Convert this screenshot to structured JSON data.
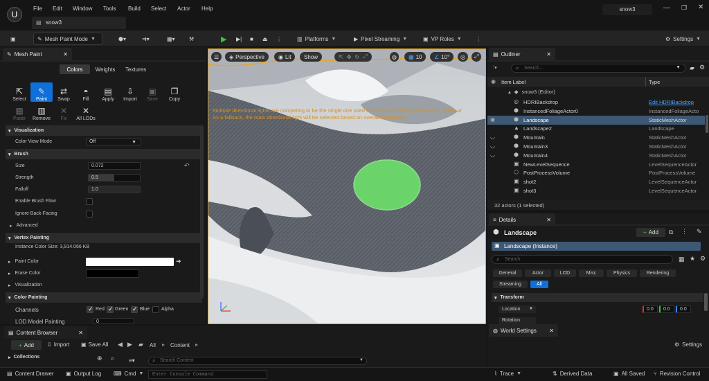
{
  "app": {
    "menu": [
      "File",
      "Edit",
      "Window",
      "Tools",
      "Build",
      "Select",
      "Actor",
      "Help"
    ],
    "project_name": "snow3",
    "doc_tab": "snow3"
  },
  "toolbar": {
    "mode": "Mesh Paint Mode",
    "platforms": "Platforms",
    "pixel_streaming": "Pixel Streaming",
    "vp_roles": "VP Roles",
    "settings": "Settings"
  },
  "mesh_paint": {
    "tab_title": "Mesh Paint",
    "segments": [
      "Colors",
      "Weights",
      "Textures"
    ],
    "tools_row1": [
      {
        "label": "Select",
        "icon": "cursor-icon",
        "glyph": "⇱",
        "dim": false
      },
      {
        "label": "Paint",
        "icon": "paint-brush-icon",
        "glyph": "✎",
        "dim": false,
        "active": true
      },
      {
        "label": "Swap",
        "icon": "swap-icon",
        "glyph": "⇄",
        "dim": false
      },
      {
        "label": "Fill",
        "icon": "fill-bucket-icon",
        "glyph": "◓",
        "dim": false
      },
      {
        "label": "Apply",
        "icon": "apply-icon",
        "glyph": "▤",
        "dim": false
      },
      {
        "label": "Import",
        "icon": "import-icon",
        "glyph": "⇩",
        "dim": false
      },
      {
        "label": "Save",
        "icon": "save-icon",
        "glyph": "▣",
        "dim": true
      },
      {
        "label": "Copy",
        "icon": "copy-icon",
        "glyph": "❐",
        "dim": false
      }
    ],
    "tools_row2": [
      {
        "label": "Paste",
        "icon": "paste-icon",
        "glyph": "▦",
        "dim": true
      },
      {
        "label": "Remove",
        "icon": "remove-icon",
        "glyph": "▥",
        "dim": false
      },
      {
        "label": "Fix",
        "icon": "fix-icon",
        "glyph": "✕",
        "dim": true
      },
      {
        "label": "All LODs",
        "icon": "lods-icon",
        "glyph": "✕",
        "dim": false
      }
    ],
    "visualization": {
      "header": "Visualization",
      "color_view_mode_label": "Color View Mode",
      "color_view_mode_value": "Off"
    },
    "brush": {
      "header": "Brush",
      "size_label": "Size",
      "size_value": "0.072",
      "strength_label": "Strength",
      "strength_value": "0.5",
      "falloff_label": "Falloff",
      "falloff_value": "1.0",
      "flow_label": "Enable Brush Flow",
      "backface_label": "Ignore Back-Facing"
    },
    "advanced": "Advanced",
    "vertex_painting": {
      "header": "Vertex Painting",
      "instance_size": "Instance Color Size: 3,914.066 KB",
      "paint_color_label": "Paint Color",
      "erase_color_label": "Erase Color",
      "visualization_label": "Visualization"
    },
    "color_painting": {
      "header": "Color Painting",
      "channels_label": "Channels",
      "channels": [
        "Red",
        "Green",
        "Blue",
        "Alpha"
      ],
      "lod_label": "LOD Model Painting",
      "lod_value": "0"
    }
  },
  "viewport": {
    "perspective": "Perspective",
    "lit": "Lit",
    "show": "Show",
    "grid_value": "10",
    "angle_value": "10°",
    "warning_line1": "Multiple directional lights are competing to be the single one used for forward shading, translucent, water or",
    "warning_line2": "As a fallback, the main directional light will be selected based on overall brightness.",
    "brush_color": "#6de86a",
    "border_color": "#d79d29"
  },
  "outliner": {
    "title": "Outliner",
    "search_placeholder": "Search...",
    "col_label": "Item Label",
    "col_type": "Type",
    "root": "snow3 (Editor)",
    "rows": [
      {
        "label": "HDRIBackdrop",
        "type": "Edit HDRIBackdrop",
        "link": true
      },
      {
        "label": "InstancedFoliageActor0",
        "type": "InstancedFoliageActo"
      },
      {
        "label": "Landscape",
        "type": "StaticMeshActor",
        "selected": true
      },
      {
        "label": "Landscape2",
        "type": "Landscape"
      },
      {
        "label": "Mountain",
        "type": "StaticMeshActor"
      },
      {
        "label": "Mountain3",
        "type": "StaticMeshActor"
      },
      {
        "label": "Mountain4",
        "type": "StaticMeshActor"
      },
      {
        "label": "NewLevelSequence",
        "type": "LevelSequenceActor"
      },
      {
        "label": "PostProcessVolume",
        "type": "PostProcessVolume"
      },
      {
        "label": "shot2",
        "type": "LevelSequenceActor"
      },
      {
        "label": "shot3",
        "type": "LevelSequenceActor"
      }
    ],
    "status": "32 actors (1 selected)"
  },
  "details": {
    "title": "Details",
    "actor_name": "Landscape",
    "add": "Add",
    "instance": "Landscape (Instance)",
    "search_placeholder": "Search",
    "filters": [
      "General",
      "Actor",
      "LOD",
      "Misc",
      "Physics",
      "Rendering",
      "Streaming",
      "All"
    ],
    "transform_header": "Transform",
    "location_label": "Location",
    "rotation_label": "Rotation",
    "loc_x": "0.0",
    "loc_y": "0.0",
    "loc_z": "0.0"
  },
  "content_browser": {
    "title": "Content Browser",
    "add": "Add",
    "import": "Import",
    "save_all": "Save All",
    "path_all": "All",
    "path_content": "Content",
    "settings": "Settings",
    "collections": "Collections",
    "search_placeholder": "Search Content"
  },
  "world_settings": {
    "title": "World Settings"
  },
  "statusbar": {
    "content_drawer": "Content Drawer",
    "output_log": "Output Log",
    "cmd": "Cmd",
    "console_placeholder": "Enter Console Command",
    "trace": "Trace",
    "derived_data": "Derived Data",
    "all_saved": "All Saved",
    "revision_control": "Revision Control"
  }
}
